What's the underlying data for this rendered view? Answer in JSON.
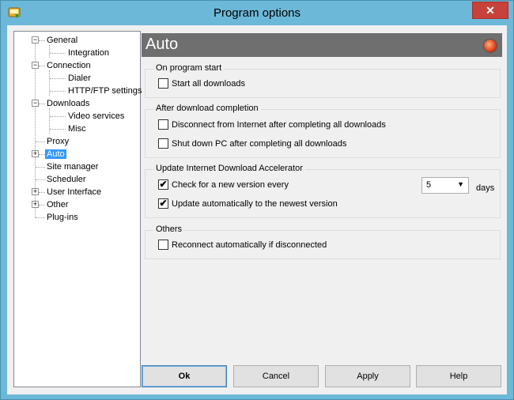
{
  "window": {
    "title": "Program options",
    "close_glyph": "✕"
  },
  "tree": {
    "items": [
      {
        "label": "General"
      },
      {
        "label": "Integration"
      },
      {
        "label": "Connection"
      },
      {
        "label": "Dialer"
      },
      {
        "label": "HTTP/FTP settings"
      },
      {
        "label": "Downloads"
      },
      {
        "label": "Video services"
      },
      {
        "label": "Misc"
      },
      {
        "label": "Proxy"
      },
      {
        "label": "Auto"
      },
      {
        "label": "Site manager"
      },
      {
        "label": "Scheduler"
      },
      {
        "label": "User Interface"
      },
      {
        "label": "Other"
      },
      {
        "label": "Plug-ins"
      }
    ],
    "selected": "Auto",
    "expand_minus": "−",
    "expand_plus": "+"
  },
  "panel": {
    "title": "Auto",
    "groups": {
      "start": {
        "title": "On program start",
        "items": [
          {
            "label": "Start all downloads",
            "checked": false
          }
        ]
      },
      "after": {
        "title": "After download completion",
        "items": [
          {
            "label": "Disconnect from Internet after completing all downloads",
            "checked": false
          },
          {
            "label": "Shut down PC after completing all downloads",
            "checked": false
          }
        ]
      },
      "update": {
        "title": "Update Internet Download Accelerator",
        "items": [
          {
            "label": "Check for a new version every",
            "checked": true
          },
          {
            "label": "Update automatically to the newest version",
            "checked": true
          }
        ],
        "interval_value": "5",
        "interval_unit": "days"
      },
      "others": {
        "title": "Others",
        "items": [
          {
            "label": "Reconnect automatically if disconnected",
            "checked": false
          }
        ]
      }
    }
  },
  "buttons": {
    "ok": "Ok",
    "cancel": "Cancel",
    "apply": "Apply",
    "help": "Help"
  },
  "check_glyph": "✔",
  "colors": {
    "selection": "#3399ff",
    "header_bg": "#6f6f6f",
    "titlebar": "#6cb8d8",
    "close": "#c7423a"
  }
}
